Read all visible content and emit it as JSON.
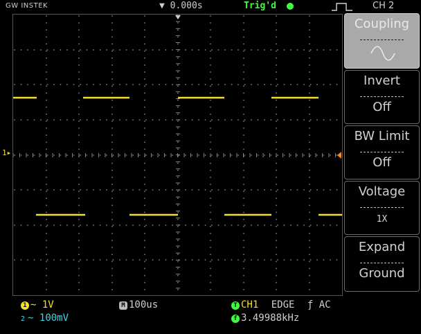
{
  "topbar": {
    "brand": "GW INSTEK",
    "time_position": "▼ 0.000s",
    "trigger_status": "Trig'd",
    "channel_label": "CH 2"
  },
  "screen": {
    "ch1_marker": "1▸"
  },
  "menu": {
    "coupling": {
      "title": "Coupling",
      "value": "∼"
    },
    "invert": {
      "title": "Invert",
      "value": "Off"
    },
    "bw_limit": {
      "title": "BW Limit",
      "value": "Off"
    },
    "voltage": {
      "title": "Voltage",
      "value": "1X"
    },
    "expand": {
      "title": "Expand",
      "value": "Ground"
    }
  },
  "bottom": {
    "ch1_badge": "1",
    "ch1_scale": "∼ 1V",
    "ch2_badge": "2",
    "ch2_scale": "∼ 100mV",
    "timebase_badge": "M",
    "timebase": "100us",
    "trig_badge": "T",
    "trig_source": "CH1",
    "trig_type": "EDGE",
    "trig_slope_coupling": "ƒ AC",
    "freq_badge": "f",
    "frequency": "3.49988kHz"
  },
  "colors": {
    "ch1": "#f2e02a",
    "ch2": "#38d8e8",
    "trigger": "#3cff3c",
    "grid": "#8a8a8a"
  }
}
